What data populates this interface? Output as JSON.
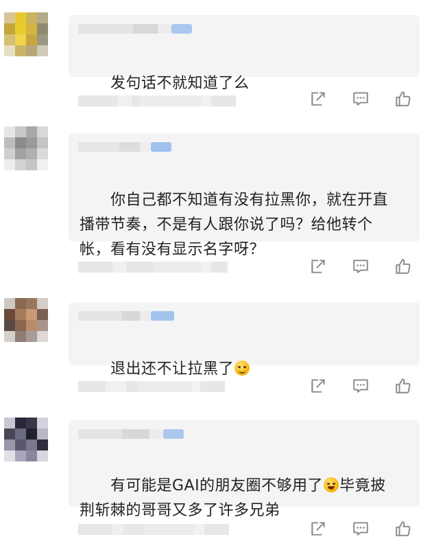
{
  "comments": [
    {
      "text": "发句话不就知道了么",
      "emoji": null,
      "avatar_colors": [
        "#d8c69a",
        "#e6c830",
        "#c9b360",
        "#b4ac88",
        "#c3a73a",
        "#e8cc2a",
        "#d4b544",
        "#8d8a70",
        "#d6c074",
        "#f0d44a",
        "#c8a640",
        "#9a9882",
        "#e8e0c4",
        "#c9b468",
        "#b8a878",
        "#d0cbb8"
      ]
    },
    {
      "text": "你自己都不知道有没有拉黑你，就在开直播带节奏，不是有人跟你说了吗？给他转个帐，看有没有显示名字呀？",
      "emoji": null,
      "avatar_colors": [
        "#e6e6e6",
        "#c8c8c8",
        "#a8a8a8",
        "#d8d8d8",
        "#bdbdbd",
        "#8c8c8c",
        "#9a9a9a",
        "#c4c4c4",
        "#cfcfcf",
        "#a2a2a2",
        "#b0b0b0",
        "#dadada",
        "#eeeeee",
        "#d2d2d2",
        "#c6c6c6",
        "#f0f0f0"
      ]
    },
    {
      "text": "退出还不让拉黑了",
      "emoji": "grin",
      "avatar_colors": [
        "#cfc8c2",
        "#8a6a52",
        "#9a7660",
        "#d4ccc6",
        "#6a4a3a",
        "#a57c5c",
        "#c89a76",
        "#7a5e50",
        "#5a4a44",
        "#8a6650",
        "#b88c6a",
        "#a8948a",
        "#d6d0cc",
        "#8f7e76",
        "#a89c96",
        "#ddd8d4"
      ]
    },
    {
      "text": "有可能是GAI的朋友圈不够用了",
      "text_after_emoji": "毕竟披荆斩棘的哥哥又多了许多兄弟",
      "emoji": "laugh",
      "avatar_colors": [
        "#c8c6d2",
        "#2a2838",
        "#3a3648",
        "#d4d2dc",
        "#4a4658",
        "#6a6a80",
        "#20202e",
        "#b8b6c4",
        "#9896a8",
        "#5a5870",
        "#7a788e",
        "#2e2c3c",
        "#e0dee6",
        "#a8a6b8",
        "#8886a0",
        "#d8d6e0"
      ]
    }
  ],
  "actions": {
    "share_icon": "share-icon",
    "comment_icon": "comment-icon",
    "like_icon": "thumbs-up-icon"
  },
  "colors": {
    "bubble_bg": "#f4f4f4",
    "text": "#222222",
    "icon": "#8a8a8a",
    "name_blur_accent": "#aac8ee"
  }
}
